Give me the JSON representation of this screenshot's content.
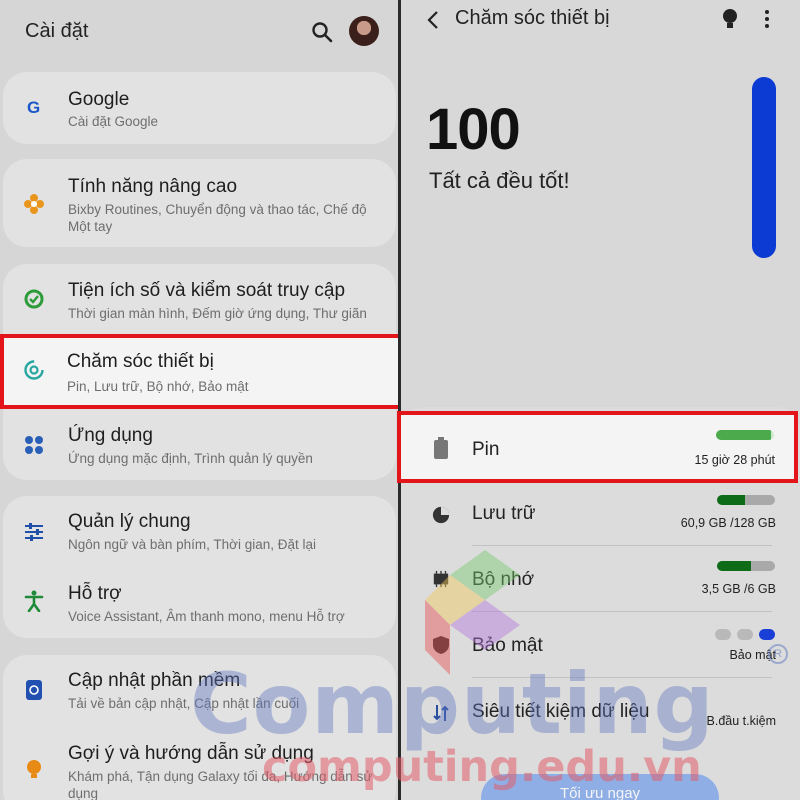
{
  "left": {
    "title": "Cài đặt",
    "items": [
      {
        "title": "Google",
        "subtitle": "Cài đặt Google",
        "icon": "google-icon"
      },
      {
        "title": "Tính năng nâng cao",
        "subtitle": "Bixby Routines, Chuyển động và thao tác, Chế độ Một tay",
        "icon": "advanced-features-icon"
      },
      {
        "title": "Tiện ích số và kiểm soát truy cập",
        "subtitle": "Thời gian màn hình, Đếm giờ ứng dụng, Thư giãn",
        "icon": "digital-wellbeing-icon"
      },
      {
        "title": "Chăm sóc thiết bị",
        "subtitle": "Pin, Lưu trữ, Bộ nhớ, Bảo mật",
        "icon": "device-care-icon"
      },
      {
        "title": "Ứng dụng",
        "subtitle": "Ứng dụng mặc định, Trình quản lý quyền",
        "icon": "apps-icon"
      },
      {
        "title": "Quản lý chung",
        "subtitle": "Ngôn ngữ và bàn phím, Thời gian, Đặt lại",
        "icon": "general-management-icon"
      },
      {
        "title": "Hỗ trợ",
        "subtitle": "Voice Assistant, Âm thanh mono, menu Hỗ trợ",
        "icon": "accessibility-icon"
      },
      {
        "title": "Cập nhật phần mềm",
        "subtitle": "Tải về bản cập nhật, Cập nhật lần cuối",
        "icon": "software-update-icon"
      },
      {
        "title": "Gợi ý và hướng dẫn sử dụng",
        "subtitle": "Khám phá, Tận dụng Galaxy tối đa, Hướng dẫn sử dụng",
        "icon": "tips-icon"
      }
    ]
  },
  "right": {
    "title": "Chăm sóc thiết bị",
    "score": "100",
    "score_text": "Tất cả đều tốt!",
    "score_level": 1.0,
    "items": [
      {
        "label": "Pin",
        "value": "15 giờ 28 phút",
        "icon": "battery-icon",
        "level": 0.95
      },
      {
        "label": "Lưu trữ",
        "value": "60,9 GB /128 GB",
        "icon": "storage-icon",
        "level": 0.48
      },
      {
        "label": "Bộ nhớ",
        "value": "3,5 GB /6 GB",
        "icon": "memory-icon",
        "level": 0.58
      },
      {
        "label": "Bảo mật",
        "value": "Bảo mật",
        "icon": "security-icon"
      },
      {
        "label": "Siêu tiết kiệm dữ liệu",
        "value": "B.đầu t.kiệm",
        "icon": "data-saver-icon"
      }
    ],
    "optimize_button": "Tối ưu ngay"
  },
  "watermark": {
    "brand": "Computing",
    "site": "computing.edu.vn",
    "reg": "R"
  },
  "colors": {
    "highlight_border": "#e3151a",
    "score_bar": "#0b3bd3",
    "battery_fill": "#4caa4c",
    "usage_fill": "#0e6b17"
  }
}
